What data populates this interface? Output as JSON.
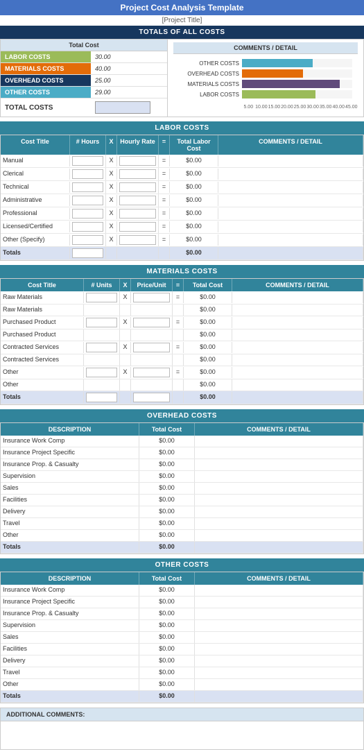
{
  "title": "Project Cost Analysis Template",
  "subtitle": "[Project Title]",
  "totals_section": {
    "header": "TOTALS OF ALL COSTS",
    "col_header": "Total Cost",
    "comment_header": "COMMENTS / DETAIL",
    "rows": [
      {
        "label": "LABOR COSTS",
        "value": "30.00",
        "color": "#9bbb59"
      },
      {
        "label": "MATERIALS COSTS",
        "value": "40.00",
        "color": "#e36c09"
      },
      {
        "label": "OVERHEAD COSTS",
        "value": "25.00",
        "color": "#17375e"
      },
      {
        "label": "OTHER COSTS",
        "value": "29.00",
        "color": "#4bacc6"
      }
    ],
    "total_label": "TOTAL COSTS"
  },
  "chart": {
    "bars": [
      {
        "label": "LABOR COSTS",
        "value": 30,
        "max": 45,
        "color": "#9bbb59"
      },
      {
        "label": "MATERIALS COSTS",
        "value": 40,
        "max": 45,
        "color": "#604a7b"
      },
      {
        "label": "OVERHEAD COSTS",
        "value": 25,
        "max": 45,
        "color": "#e36c09"
      },
      {
        "label": "OTHER COSTS",
        "value": 29,
        "max": 45,
        "color": "#4bacc6"
      }
    ],
    "axis_labels": [
      "5.00",
      "10.00",
      "15.00",
      "20.00",
      "25.00",
      "30.00",
      "35.00",
      "40.00",
      "45.00"
    ]
  },
  "labor_section": {
    "header": "LABOR COSTS",
    "columns": [
      "Cost Title",
      "# Hours",
      "X",
      "Hourly Rate",
      "=",
      "Total Labor Cost",
      "COMMENTS / DETAIL"
    ],
    "rows": [
      {
        "title": "Manual"
      },
      {
        "title": "Clerical"
      },
      {
        "title": "Technical"
      },
      {
        "title": "Administrative"
      },
      {
        "title": "Professional"
      },
      {
        "title": "Licensed/Certified"
      },
      {
        "title": "Other (Specify)"
      }
    ],
    "totals_label": "Totals",
    "dollar_default": "$0.00"
  },
  "materials_section": {
    "header": "MATERIALS COSTS",
    "columns": [
      "Cost Title",
      "# Units",
      "X",
      "Price/Unit",
      "=",
      "Total Cost",
      "COMMENTS / DETAIL"
    ],
    "rows": [
      {
        "title": "Raw Materials"
      },
      {
        "title": "Raw Materials"
      },
      {
        "title": "Purchased Product"
      },
      {
        "title": "Purchased Product"
      },
      {
        "title": "Contracted Services"
      },
      {
        "title": "Contracted Services"
      },
      {
        "title": "Other"
      },
      {
        "title": "Other"
      }
    ],
    "totals_label": "Totals",
    "dollar_default": "$0.00"
  },
  "overhead_section": {
    "header": "OVERHEAD COSTS",
    "columns": [
      "DESCRIPTION",
      "Total Cost",
      "COMMENTS / DETAIL"
    ],
    "rows": [
      {
        "title": "Insurance Work Comp"
      },
      {
        "title": "Insurance Project Specific"
      },
      {
        "title": "Insurance Prop. & Casualty"
      },
      {
        "title": "Supervision"
      },
      {
        "title": "Sales"
      },
      {
        "title": "Facilities"
      },
      {
        "title": "Delivery"
      },
      {
        "title": "Travel"
      },
      {
        "title": "Other"
      }
    ],
    "totals_label": "Totals",
    "dollar_default": "$0.00"
  },
  "other_section": {
    "header": "OTHER COSTS",
    "columns": [
      "DESCRIPTION",
      "Total Cost",
      "COMMENTS / DETAIL"
    ],
    "rows": [
      {
        "title": "Insurance Work Comp"
      },
      {
        "title": "Insurance Project Specific"
      },
      {
        "title": "Insurance Prop. & Casualty"
      },
      {
        "title": "Supervision"
      },
      {
        "title": "Sales"
      },
      {
        "title": "Facilities"
      },
      {
        "title": "Delivery"
      },
      {
        "title": "Travel"
      },
      {
        "title": "Other"
      }
    ],
    "totals_label": "Totals",
    "dollar_default": "$0.00"
  },
  "additional": {
    "header": "ADDITIONAL COMMENTS:"
  }
}
